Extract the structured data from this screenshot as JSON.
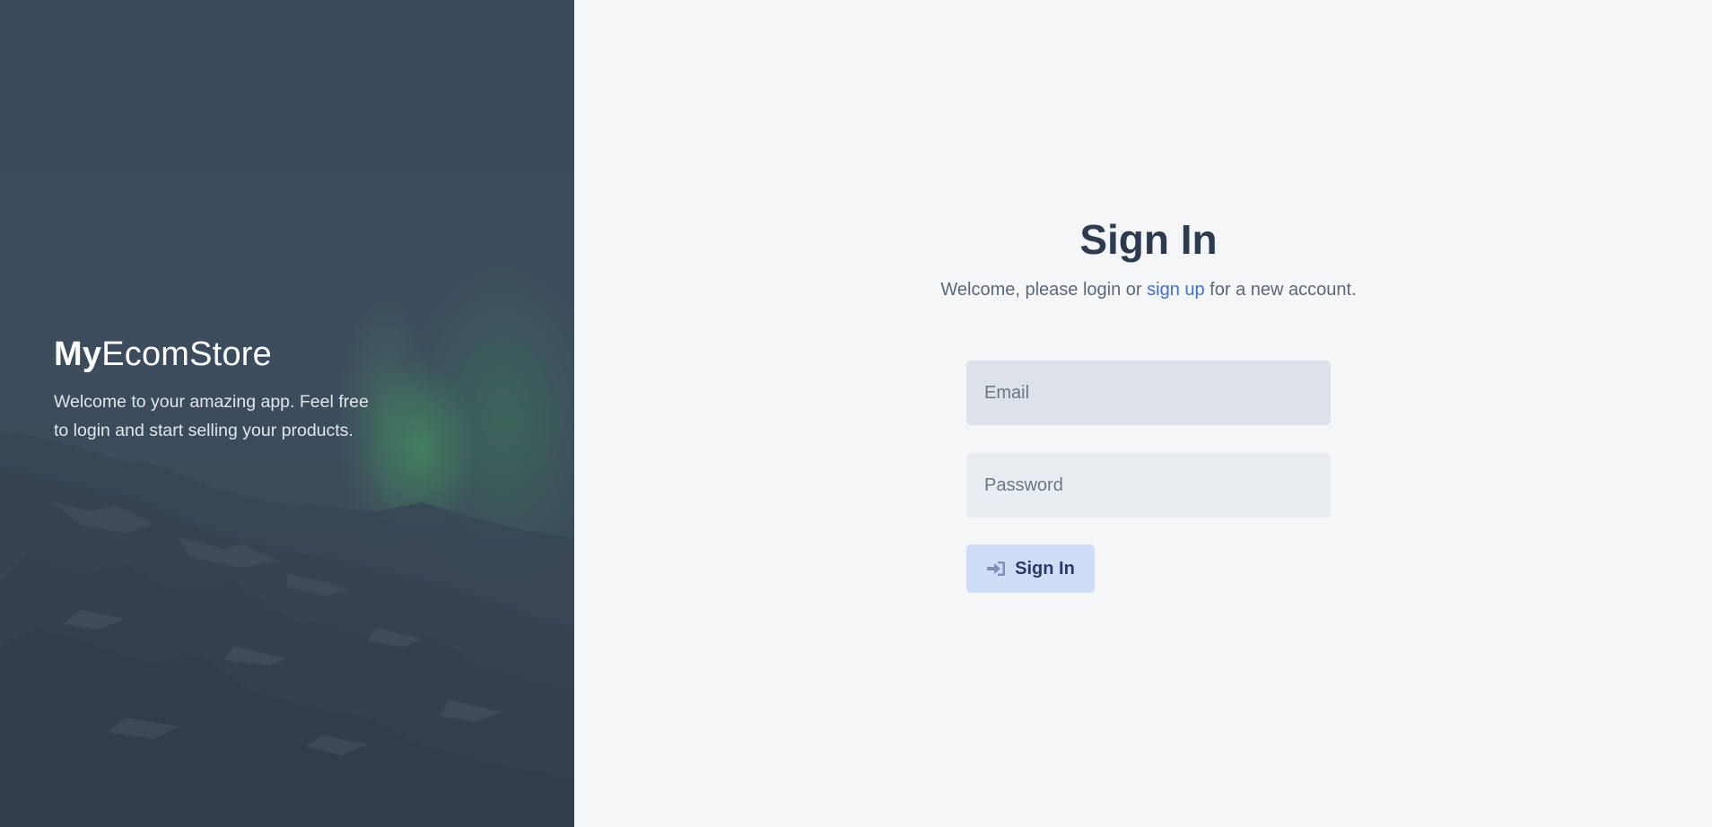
{
  "brand": {
    "bold": "My",
    "light": "EcomStore"
  },
  "hero": {
    "tagline": "Welcome to your amazing app. Feel free to login and start selling your products."
  },
  "signin": {
    "title": "Sign In",
    "subtitle_prefix": "Welcome, please login or ",
    "signup_link": "sign up",
    "subtitle_suffix": " for a new account.",
    "email_placeholder": "Email",
    "password_placeholder": "Password",
    "button_label": "Sign In",
    "button_icon": "sign-in-icon"
  },
  "colors": {
    "title": "#2d3a50",
    "link": "#3f6fd8",
    "button_bg": "#d0ddf7",
    "button_text": "#2a3a69",
    "panel_bg": "#f4f6f8",
    "hero_bg": "#3c4b5c",
    "aurora": "#4caa68"
  }
}
